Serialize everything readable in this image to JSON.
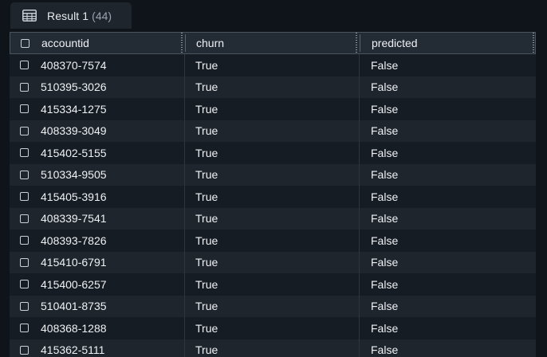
{
  "tab": {
    "icon": "table-icon",
    "label": "Result 1",
    "count": "(44)"
  },
  "columns": [
    {
      "key": "accountid",
      "label": "accountid"
    },
    {
      "key": "churn",
      "label": "churn"
    },
    {
      "key": "predicted",
      "label": "predicted"
    }
  ],
  "rows": [
    {
      "accountid": "408370-7574",
      "churn": "True",
      "predicted": "False"
    },
    {
      "accountid": "510395-3026",
      "churn": "True",
      "predicted": "False"
    },
    {
      "accountid": "415334-1275",
      "churn": "True",
      "predicted": "False"
    },
    {
      "accountid": "408339-3049",
      "churn": "True",
      "predicted": "False"
    },
    {
      "accountid": "415402-5155",
      "churn": "True",
      "predicted": "False"
    },
    {
      "accountid": "510334-9505",
      "churn": "True",
      "predicted": "False"
    },
    {
      "accountid": "415405-3916",
      "churn": "True",
      "predicted": "False"
    },
    {
      "accountid": "408339-7541",
      "churn": "True",
      "predicted": "False"
    },
    {
      "accountid": "408393-7826",
      "churn": "True",
      "predicted": "False"
    },
    {
      "accountid": "415410-6791",
      "churn": "True",
      "predicted": "False"
    },
    {
      "accountid": "415400-6257",
      "churn": "True",
      "predicted": "False"
    },
    {
      "accountid": "510401-8735",
      "churn": "True",
      "predicted": "False"
    },
    {
      "accountid": "408368-1288",
      "churn": "True",
      "predicted": "False"
    },
    {
      "accountid": "415362-5111",
      "churn": "True",
      "predicted": "False"
    }
  ]
}
